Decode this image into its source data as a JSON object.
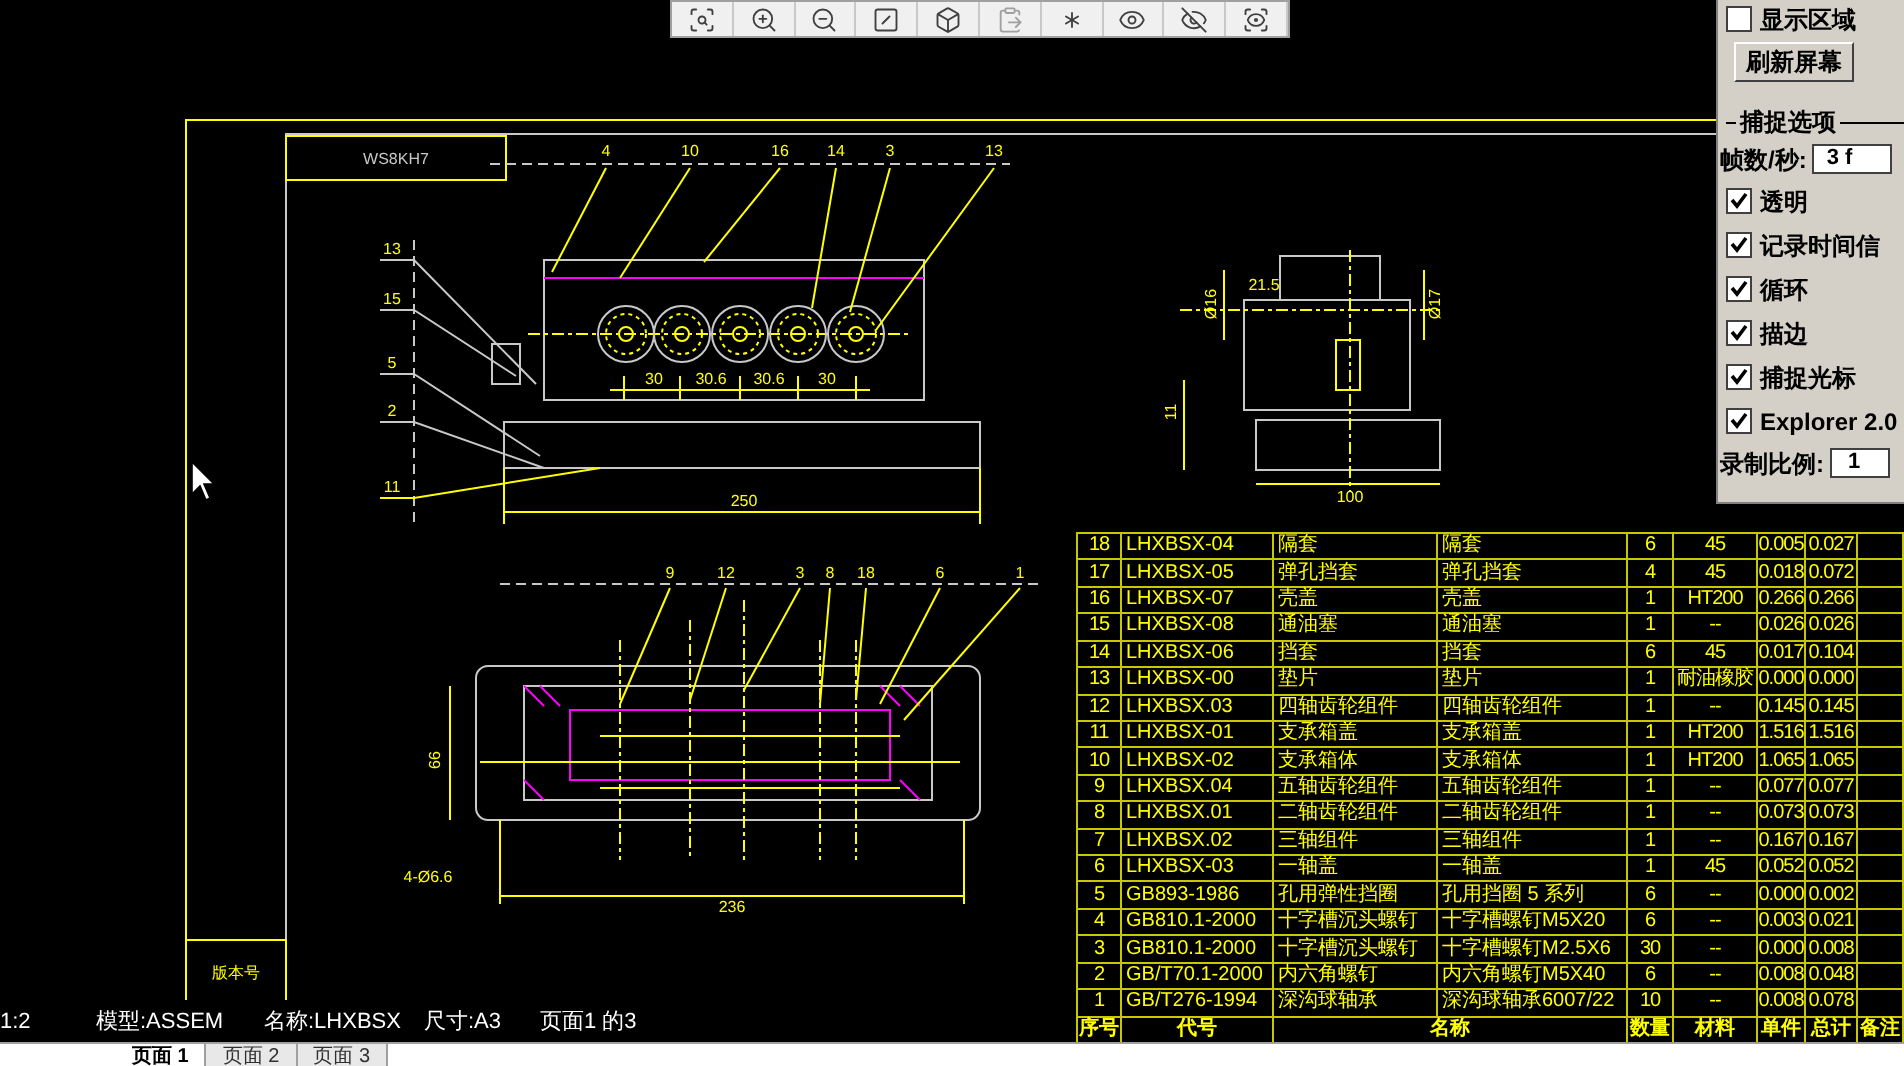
{
  "capture_panel": {
    "show_area": {
      "label": "显示区域",
      "checked": false
    },
    "refresh_button": "刷新屏幕",
    "section_title": "捕捉选项",
    "fps": {
      "label": "帧数/秒:",
      "value": "3 f"
    },
    "options": [
      {
        "label": "透明",
        "checked": true
      },
      {
        "label": "记录时间信",
        "checked": true
      },
      {
        "label": "循环",
        "checked": true
      },
      {
        "label": "描边",
        "checked": true
      },
      {
        "label": "捕捉光标",
        "checked": true
      },
      {
        "label": "Explorer 2.0",
        "checked": true
      }
    ],
    "scale": {
      "label": "录制比例:",
      "value": "1"
    }
  },
  "drawing": {
    "title_block": "WS8KH7",
    "top_callouts": [
      "4",
      "10",
      "16",
      "14",
      "3",
      "13"
    ],
    "side_callouts": [
      "13",
      "15",
      "5",
      "2",
      "11"
    ],
    "gear_spacing": [
      "30",
      "30.6",
      "30.6",
      "30"
    ],
    "length_dim": "250",
    "side_view_dims": [
      "21.5",
      "Ø16",
      "Ø17",
      "11",
      "100"
    ],
    "section_callouts": [
      "9",
      "12",
      "3",
      "8",
      "18",
      "6",
      "1"
    ],
    "section_dims": [
      "66",
      "236",
      "4-Ø6.6"
    ],
    "revision_label": "版本号"
  },
  "bom": {
    "header": [
      "序号",
      "代号",
      "名称",
      "数量",
      "材料",
      "单件",
      "总计",
      "备注"
    ],
    "rows": [
      [
        "18",
        "LHXBSX-04",
        "隔套",
        "隔套",
        "6",
        "45",
        "0.005",
        "0.027"
      ],
      [
        "17",
        "LHXBSX-05",
        "弹孔挡套",
        "弹孔挡套",
        "4",
        "45",
        "0.018",
        "0.072"
      ],
      [
        "16",
        "LHXBSX-07",
        "壳盖",
        "壳盖",
        "1",
        "HT200",
        "0.266",
        "0.266"
      ],
      [
        "15",
        "LHXBSX-08",
        "通油塞",
        "通油塞",
        "1",
        "--",
        "0.026",
        "0.026"
      ],
      [
        "14",
        "LHXBSX-06",
        "挡套",
        "挡套",
        "6",
        "45",
        "0.017",
        "0.104"
      ],
      [
        "13",
        "LHXBSX-00",
        "垫片",
        "垫片",
        "1",
        "耐油橡胶",
        "0.000",
        "0.000"
      ],
      [
        "12",
        "LHXBSX.03",
        "四轴齿轮组件",
        "四轴齿轮组件",
        "1",
        "--",
        "0.145",
        "0.145"
      ],
      [
        "11",
        "LHXBSX-01",
        "支承箱盖",
        "支承箱盖",
        "1",
        "HT200",
        "1.516",
        "1.516"
      ],
      [
        "10",
        "LHXBSX-02",
        "支承箱体",
        "支承箱体",
        "1",
        "HT200",
        "1.065",
        "1.065"
      ],
      [
        "9",
        "LHXBSX.04",
        "五轴齿轮组件",
        "五轴齿轮组件",
        "1",
        "--",
        "0.077",
        "0.077"
      ],
      [
        "8",
        "LHXBSX.01",
        "二轴齿轮组件",
        "二轴齿轮组件",
        "1",
        "--",
        "0.073",
        "0.073"
      ],
      [
        "7",
        "LHXBSX.02",
        "三轴组件",
        "三轴组件",
        "1",
        "--",
        "0.167",
        "0.167"
      ],
      [
        "6",
        "LHXBSX-03",
        "一轴盖",
        "一轴盖",
        "1",
        "45",
        "0.052",
        "0.052"
      ],
      [
        "5",
        "GB893-1986",
        "孔用弹性挡圈",
        "孔用挡圈 5 系列",
        "6",
        "--",
        "0.000",
        "0.002"
      ],
      [
        "4",
        "GB810.1-2000",
        "十字槽沉头螺钉",
        "十字槽螺钉M5X20",
        "6",
        "--",
        "0.003",
        "0.021"
      ],
      [
        "3",
        "GB810.1-2000",
        "十字槽沉头螺钉",
        "十字槽螺钉M2.5X6",
        "30",
        "--",
        "0.000",
        "0.008"
      ],
      [
        "2",
        "GB/T70.1-2000",
        "内六角螺钉",
        "内六角螺钉M5X40",
        "6",
        "--",
        "0.008",
        "0.048"
      ],
      [
        "1",
        "GB/T276-1994",
        "深沟球轴承",
        "深沟球轴承6007/22",
        "10",
        "--",
        "0.008",
        "0.078"
      ]
    ]
  },
  "info_bar": [
    "1:2",
    "模型:ASSEM",
    "名称:LHXBSX",
    "尺寸:A3",
    "页面1 的3"
  ],
  "page_tabs": [
    {
      "label": "页面 1",
      "selected": true
    },
    {
      "label": "页面 2",
      "selected": false
    },
    {
      "label": "页面 3",
      "selected": false
    }
  ]
}
